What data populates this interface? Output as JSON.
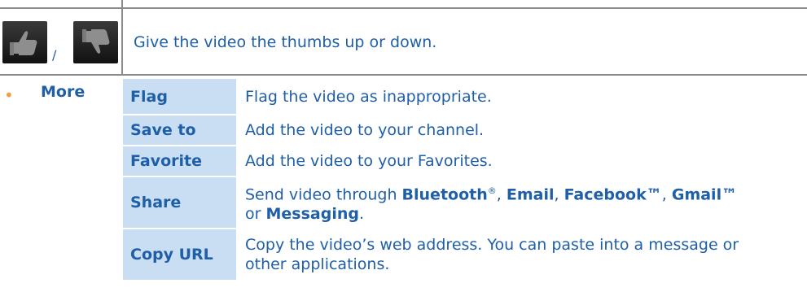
{
  "thumbs": {
    "separator": "/",
    "description": "Give the video the thumbs up or down.",
    "icons": [
      "thumbs-up-icon",
      "thumbs-down-icon"
    ]
  },
  "more": {
    "label": "More",
    "options": [
      {
        "name": "Flag",
        "desc": "Flag the video as inappropriate."
      },
      {
        "name": "Save to",
        "desc": "Add the video to your channel."
      },
      {
        "name": "Favorite",
        "desc": "Add the video to your Favorites."
      },
      {
        "name": "Share",
        "desc_prefix": "Send video through ",
        "bluetooth": "Bluetooth",
        "reg": "®",
        "sep1": ", ",
        "email": "Email",
        "sep2": ", ",
        "facebook": "Facebook™",
        "sep3": ", ",
        "gmail": "Gmail™",
        "or": " or ",
        "messaging": "Messaging",
        "end": "."
      },
      {
        "name": "Copy URL",
        "desc_line1": "Copy the video’s web address. You can paste into a message or",
        "desc_line2": "other applications."
      }
    ]
  },
  "colors": {
    "text": "#1f5fa8",
    "option_bg": "#c9def3",
    "bullet": "#f0a040",
    "rule": "#8a8a8a"
  }
}
